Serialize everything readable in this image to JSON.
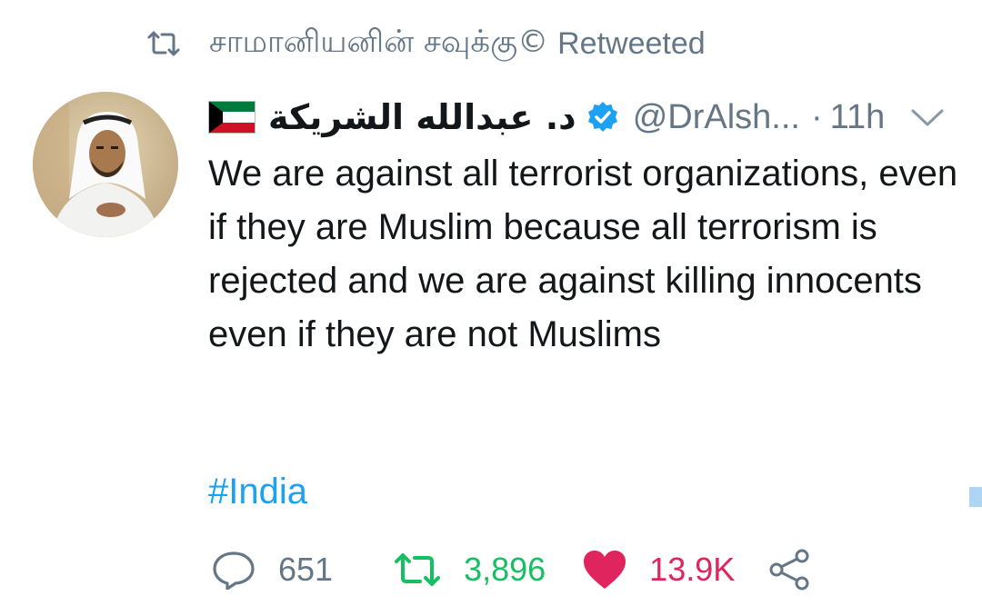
{
  "retweet_header": {
    "icon": "retweet-icon",
    "retweeter_name": "சாமானியனின் சவுக்கு©",
    "label": "Retweeted"
  },
  "author": {
    "avatar": "avatar",
    "flag_icon": "kuwait-flag-icon",
    "display_name": "د. عبدالله الشريكة",
    "verified_icon": "verified-badge-icon",
    "handle": "@DrAlsh...",
    "separator": "·",
    "time": "11h"
  },
  "tweet": {
    "text": "We are against all terrorist organizations, even if they are Muslim because all terrorism is rejected and we are against killing innocents even if they are not Muslims",
    "hashtag": "#India"
  },
  "actions": {
    "reply_count": "651",
    "retweet_count": "3,896",
    "like_count": "13.9K"
  },
  "colors": {
    "muted": "#657786",
    "text": "#14171a",
    "link": "#1da1f2",
    "retweet_green": "#17bf63",
    "like_red": "#e0245e"
  }
}
